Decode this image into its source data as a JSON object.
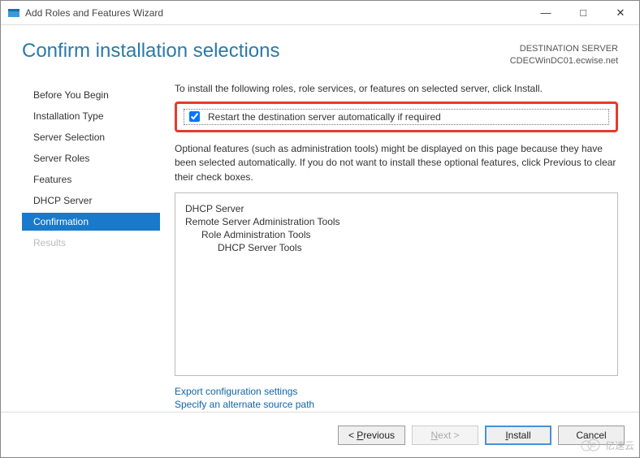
{
  "window": {
    "title": "Add Roles and Features Wizard"
  },
  "header": {
    "page_title": "Confirm installation selections",
    "dest_label": "DESTINATION SERVER",
    "dest_value": "CDECWinDC01.ecwise.net"
  },
  "sidebar": {
    "items": [
      {
        "label": "Before You Begin",
        "state": "normal"
      },
      {
        "label": "Installation Type",
        "state": "normal"
      },
      {
        "label": "Server Selection",
        "state": "normal"
      },
      {
        "label": "Server Roles",
        "state": "normal"
      },
      {
        "label": "Features",
        "state": "normal"
      },
      {
        "label": "DHCP Server",
        "state": "normal"
      },
      {
        "label": "Confirmation",
        "state": "active"
      },
      {
        "label": "Results",
        "state": "disabled"
      }
    ]
  },
  "content": {
    "instruction": "To install the following roles, role services, or features on selected server, click Install.",
    "restart_checkbox_label": "Restart the destination server automatically if required",
    "restart_checked": true,
    "optional_text": "Optional features (such as administration tools) might be displayed on this page because they have been selected automatically. If you do not want to install these optional features, click Previous to clear their check boxes.",
    "roles": [
      {
        "label": "DHCP Server",
        "level": 0
      },
      {
        "label": "Remote Server Administration Tools",
        "level": 0
      },
      {
        "label": "Role Administration Tools",
        "level": 1
      },
      {
        "label": "DHCP Server Tools",
        "level": 2
      }
    ],
    "links": {
      "export": "Export configuration settings",
      "alt_source": "Specify an alternate source path"
    }
  },
  "footer": {
    "previous": "Previous",
    "next": "Next >",
    "install": "Install",
    "cancel": "Cancel"
  },
  "watermark": "亿速云"
}
